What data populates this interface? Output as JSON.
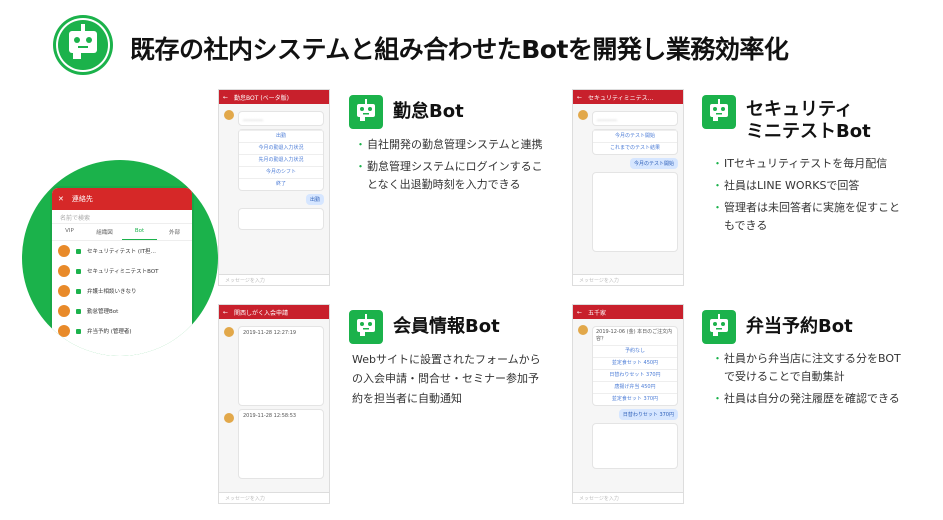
{
  "header": {
    "title": "既存の社内システムと組み合わせたBotを開発し業務効率化",
    "icon": "bot-icon"
  },
  "colors": {
    "accent": "#1bb24b",
    "app_header": "#c8202c"
  },
  "contacts_phone": {
    "header_label": "連絡先",
    "search_placeholder": "名前で検索",
    "tabs": [
      "VIP",
      "組織図",
      "Bot",
      "外部"
    ],
    "active_tab": "Bot",
    "items": [
      "セキュリティテスト (IT担…",
      "セキュリティミニテストBOT",
      "弁護士相談いきなり",
      "勤怠管理Bot",
      "弁当予約 (管理者)"
    ]
  },
  "sections": [
    {
      "title": "勤怠Bot",
      "bullets": [
        "自社開発の勤怠管理システムと連携",
        "勤怠管理システムにログインすることなく出退勤時刻を入力できる"
      ]
    },
    {
      "title_line1": "セキュリティ",
      "title_line2": "ミニテストBot",
      "bullets": [
        "ITセキュリティテストを毎月配信",
        "社員はLINE WORKSで回答",
        "管理者は未回答者に実施を促すこともできる"
      ]
    },
    {
      "title": "会員情報Bot",
      "paragraph": "Webサイトに設置されたフォームからの入会申請・問合せ・セミナー参加予約を担当者に自動通知"
    },
    {
      "title": "弁当予約Bot",
      "bullets": [
        "社員から弁当店に注文する分をBOTで受けることで自動集計",
        "社員は自分の発注履歴を確認できる"
      ]
    }
  ],
  "phones": {
    "attendance": {
      "header": "勤怠BOT (ベータ版)",
      "options": [
        "出勤",
        "今月の勤退入力状況",
        "先月の勤退入力状況",
        "今月のシフト",
        "終了"
      ],
      "reply": "出勤",
      "footer": "メッセージを入力"
    },
    "security": {
      "header": "セキュリティミニテス…",
      "options": [
        "今月のテスト開始",
        "これまでのテスト結果"
      ],
      "reply": "今月のテスト開始",
      "footer": "メッセージを入力"
    },
    "member": {
      "header": "関西しがく入会申請",
      "msg1": "2019-11-28 12:27:19",
      "msg2": "2019-11-28 12:58:53",
      "footer": "メッセージを入力"
    },
    "bento": {
      "header": "五千家",
      "msg": "2019-12-06 (金) 本日のご注文内容？",
      "options": [
        "予約なし",
        "並定食セット 450円",
        "日替わりセット 370円",
        "唐揚げ弁当 450円",
        "並定食セット 370円"
      ],
      "reply": "日替わりセット 370円",
      "footer": "メッセージを入力"
    }
  }
}
